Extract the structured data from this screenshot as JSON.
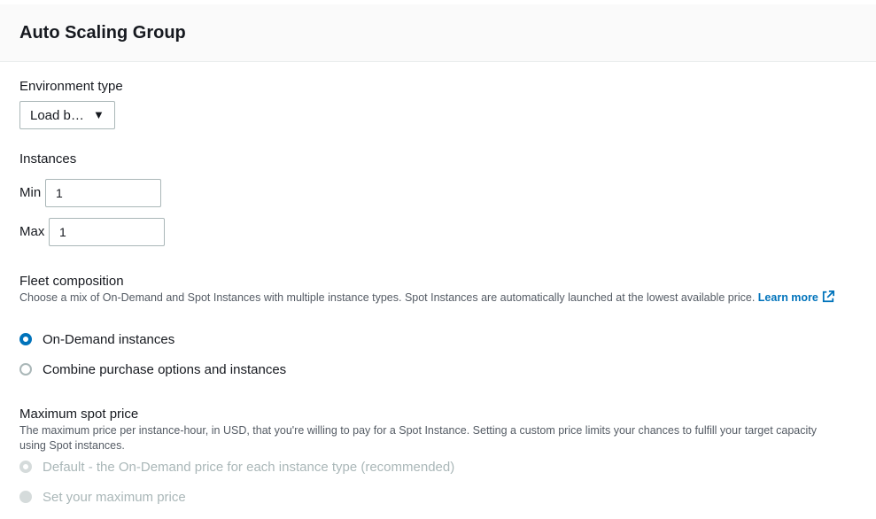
{
  "panel": {
    "title": "Auto Scaling Group"
  },
  "environment": {
    "label": "Environment type",
    "selected": "Load b…"
  },
  "instances": {
    "label": "Instances",
    "min_label": "Min",
    "min_value": "1",
    "max_label": "Max",
    "max_value": "1"
  },
  "fleet": {
    "label": "Fleet composition",
    "description": "Choose a mix of On-Demand and Spot Instances with multiple instance types. Spot Instances are automatically launched at the lowest available price.",
    "learn_more": "Learn more",
    "options": [
      {
        "label": "On-Demand instances",
        "selected": true
      },
      {
        "label": "Combine purchase options and instances",
        "selected": false
      }
    ]
  },
  "spot": {
    "label": "Maximum spot price",
    "description": "The maximum price per instance-hour, in USD, that you're willing to pay for a Spot Instance. Setting a custom price limits your chances to fulfill your target capacity using Spot instances.",
    "options": [
      {
        "label": "Default - the On-Demand price for each instance type (recommended)",
        "selected": true,
        "disabled": true
      },
      {
        "label": "Set your maximum price",
        "selected": false,
        "disabled": true
      }
    ]
  },
  "colors": {
    "accent": "#0073bb",
    "text": "#16191f",
    "muted": "#545b64",
    "disabled": "#aab7b8"
  }
}
